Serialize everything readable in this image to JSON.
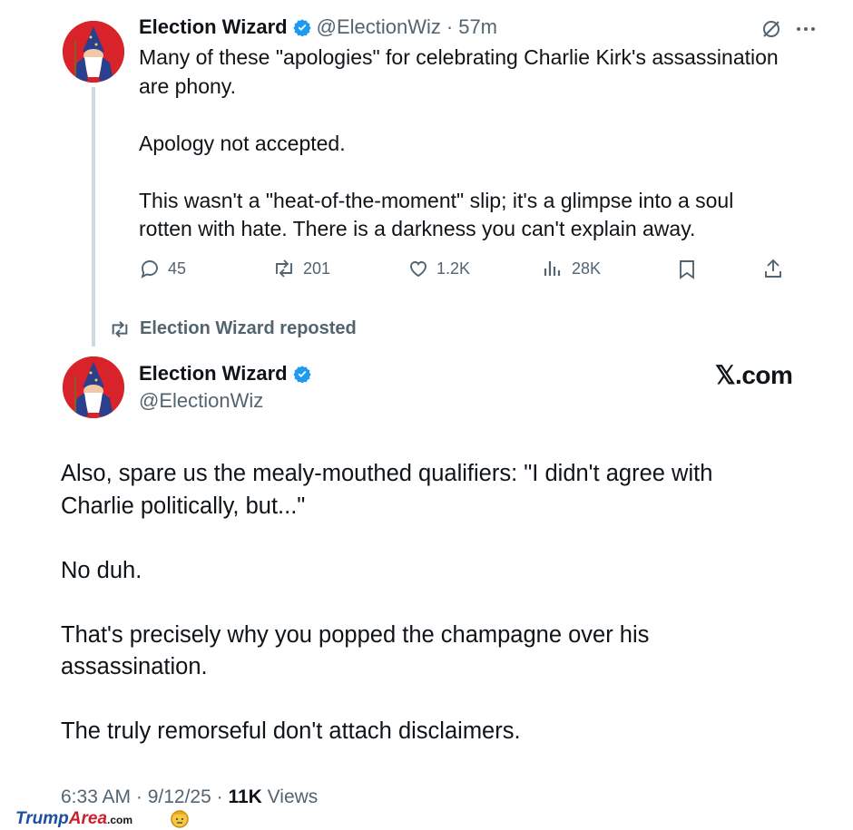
{
  "tweet1": {
    "name": "Election Wizard",
    "handle": "@ElectionWiz",
    "separator": "·",
    "time": "57m",
    "text": "Many of these \"apologies\" for celebrating Charlie Kirk's assassination\nare phony.\n\nApology not accepted.\n\nThis wasn't a \"heat-of-the-moment\" slip; it's a glimpse into a soul\nrotten with hate. There is a darkness you can't explain away.",
    "actions": {
      "replies": "45",
      "reposts": "201",
      "likes": "1.2K",
      "views": "28K"
    },
    "icons": [
      "grok-icon",
      "more-icon",
      "reply-icon",
      "repost-icon",
      "like-icon",
      "views-icon",
      "bookmark-icon",
      "share-icon"
    ]
  },
  "repost_label": "Election Wizard reposted",
  "tweet2": {
    "name": "Election Wizard",
    "handle": "@ElectionWiz",
    "brand": "𝕏.com",
    "text": "Also, spare us the mealy-mouthed qualifiers: \"I didn't agree with\nCharlie politically, but...\"\n\nNo duh.\n\nThat's precisely why you popped the champagne over his\nassassination.\n\nThe truly remorseful don't attach disclaimers.",
    "timestamp": "6:33 AM · 9/12/25 · ",
    "views_count": "11K",
    "views_label": " Views"
  },
  "watermark": {
    "part1": "Trump",
    "part2": "Area",
    "part3": ".com"
  },
  "colors": {
    "avatar_bg": "#d8232a",
    "verified": "#1d9bf0",
    "muted": "#536471",
    "text": "#0f1419",
    "thread_line": "#cfd9de"
  }
}
